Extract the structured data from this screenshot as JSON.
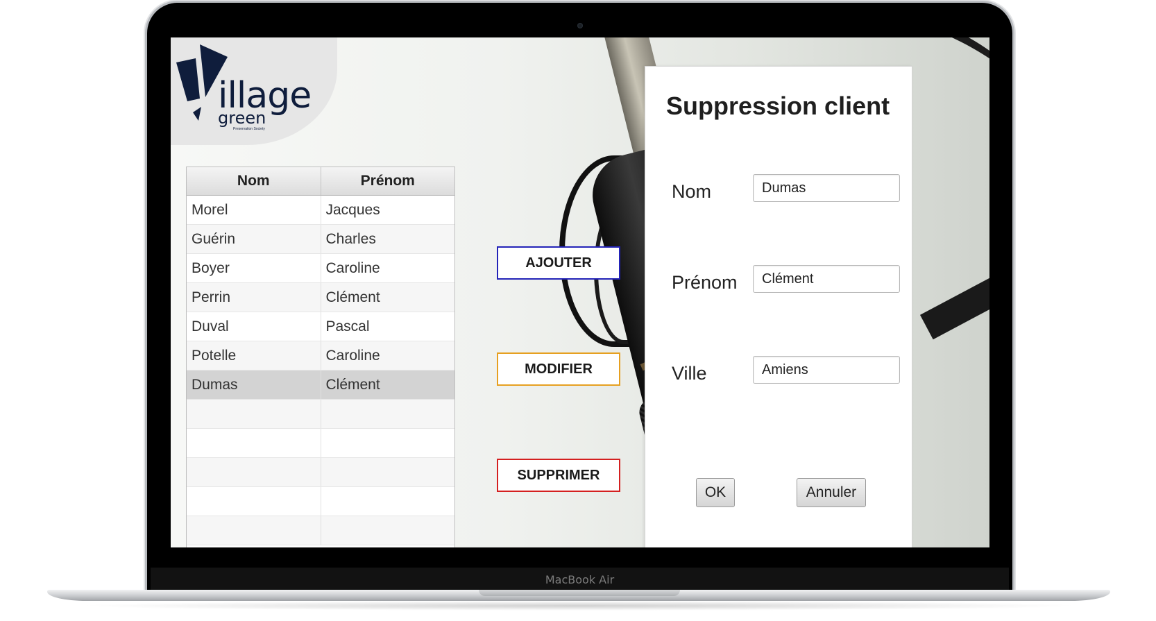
{
  "device": {
    "label": "MacBook Air"
  },
  "logo": {
    "word": "illage",
    "sub": "green",
    "tagline": "Preservation Society"
  },
  "table": {
    "columns": [
      "Nom",
      "Prénom"
    ],
    "rows": [
      {
        "nom": "Morel",
        "prenom": "Jacques"
      },
      {
        "nom": "Guérin",
        "prenom": "Charles"
      },
      {
        "nom": "Boyer",
        "prenom": "Caroline"
      },
      {
        "nom": "Perrin",
        "prenom": "Clément"
      },
      {
        "nom": "Duval",
        "prenom": "Pascal"
      },
      {
        "nom": "Potelle",
        "prenom": "Caroline"
      },
      {
        "nom": "Dumas",
        "prenom": "Clément"
      }
    ],
    "selected_index": 6
  },
  "actions": {
    "add": "AJOUTER",
    "edit": "MODIFIER",
    "delete": "SUPPRIMER",
    "colors": {
      "add": "#2323b8",
      "edit": "#e6a020",
      "delete": "#d42020"
    }
  },
  "form": {
    "title": "Suppression client",
    "fields": {
      "nom": {
        "label": "Nom",
        "value": "Dumas"
      },
      "prenom": {
        "label": "Prénom",
        "value": "Clément"
      },
      "ville": {
        "label": "Ville",
        "value": "Amiens"
      }
    },
    "ok": "OK",
    "cancel": "Annuler"
  }
}
